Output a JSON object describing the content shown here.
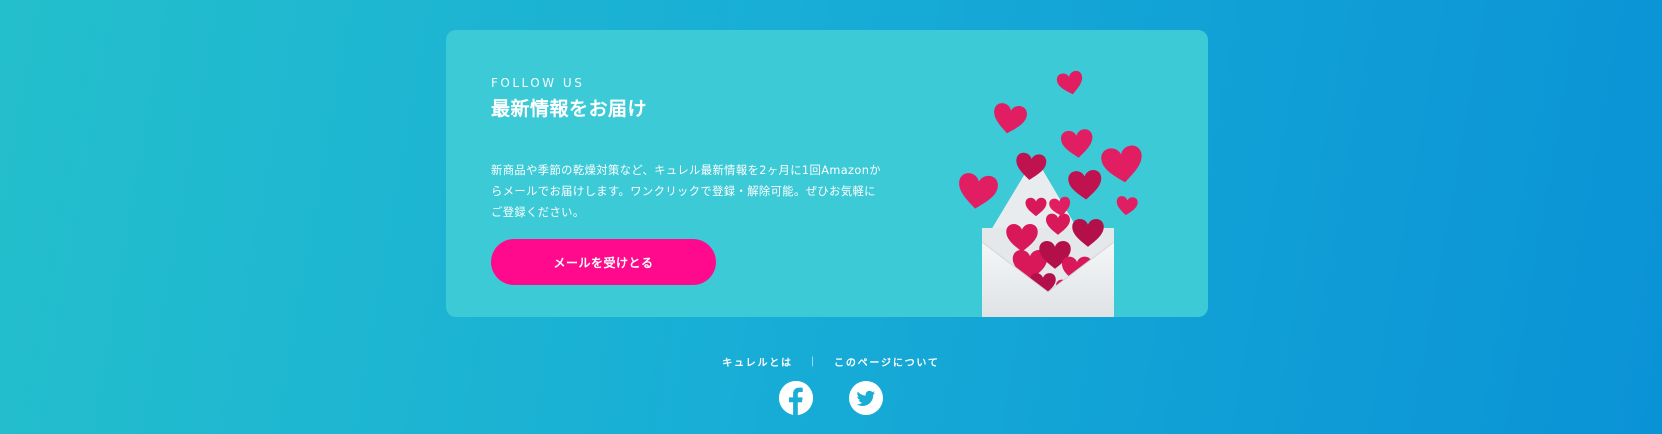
{
  "newsletter": {
    "eyebrow": "FOLLOW US",
    "title": "最新情報をお届け",
    "description_lines": [
      "新商品や季節の乾燥対策など、キュレル最新情報を2ヶ月に1回Amazonか",
      "らメールでお届けします。ワンクリックで登録・解除可能。ぜひお気軽に",
      "ご登録ください。"
    ],
    "button_label": "メールを受けとる"
  },
  "footer": {
    "links": [
      {
        "label": "キュレルとは"
      },
      {
        "label": "このページについて"
      }
    ],
    "separator": "|",
    "social": [
      {
        "icon": "facebook-icon"
      },
      {
        "icon": "twitter-icon"
      }
    ]
  },
  "colors": {
    "background_start": "#24bfcc",
    "background_end": "#0a92d6",
    "card": "#3ccad7",
    "button": "#ff0a8c",
    "heart": "#e0185f",
    "heart_dark": "#b3104a",
    "envelope": "#eef0f2"
  }
}
